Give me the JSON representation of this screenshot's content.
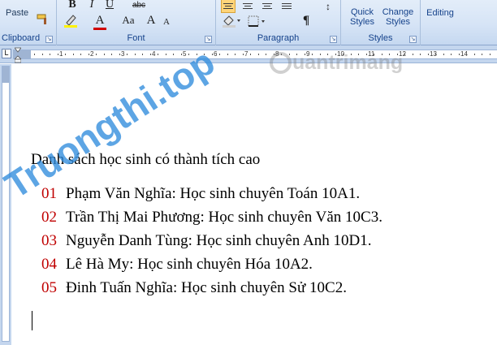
{
  "ribbon": {
    "clipboard": {
      "paste_label": "Paste",
      "group_label": "Clipboard"
    },
    "font": {
      "group_label": "Font",
      "bold": "B",
      "italic": "I",
      "underline": "U",
      "strikethrough": "abc",
      "font_color_letter": "A",
      "change_case": "Aa",
      "grow": "A",
      "shrink": "A",
      "font_color": "#d00000",
      "highlight_color": "#fff200"
    },
    "paragraph": {
      "group_label": "Paragraph",
      "pilcrow": "¶"
    },
    "styles": {
      "group_label": "Styles",
      "quick_styles": "Quick\nStyles",
      "change_styles": "Change\nStyles"
    },
    "editing": {
      "label": "Editing"
    }
  },
  "ruler": {
    "numbers": [
      "1",
      "2",
      "3",
      "4",
      "5",
      "6",
      "7",
      "8",
      "9",
      "10",
      "11",
      "12",
      "13",
      "14"
    ]
  },
  "document": {
    "heading": "Danh sách học sinh có thành tích cao",
    "items": [
      {
        "num": "01",
        "text": "Phạm Văn Nghĩa: Học sinh chuyên Toán 10A1."
      },
      {
        "num": "02",
        "text": "Trần Thị Mai Phương: Học sinh chuyên Văn 10C3."
      },
      {
        "num": "03",
        "text": "Nguyễn Danh Tùng: Học sinh chuyên Anh 10D1."
      },
      {
        "num": "04",
        "text": "Lê Hà My: Học sinh chuyên Hóa 10A2."
      },
      {
        "num": "05",
        "text": "Đinh Tuấn Nghĩa: Học sinh chuyên Sử 10C2."
      }
    ]
  },
  "watermarks": {
    "left": "Truongthi.top",
    "right": "uantrimang"
  }
}
